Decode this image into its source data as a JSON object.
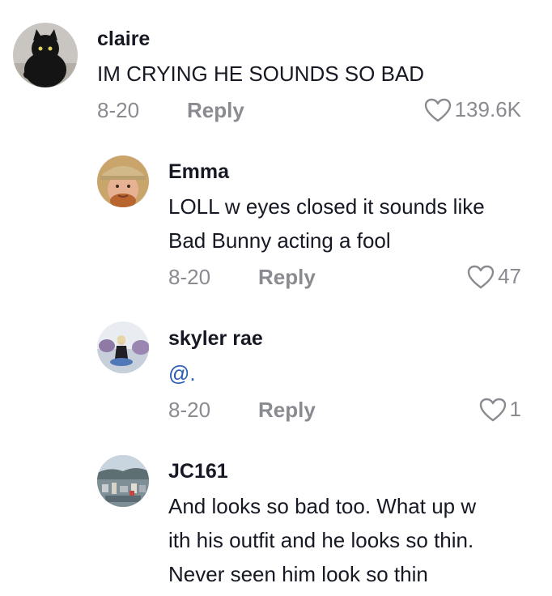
{
  "comments": [
    {
      "username": "claire",
      "text": "IM CRYING HE SOUNDS SO BAD",
      "date": "8-20",
      "reply_label": "Reply",
      "likes": "139.6K",
      "avatar_icon": "black-cat-avatar"
    },
    {
      "username": "Emma",
      "text_line1": "LOLL w eyes closed it sounds like",
      "text_line2": "Bad Bunny acting a fool",
      "date": "8-20",
      "reply_label": "Reply",
      "likes": "47",
      "avatar_icon": "ginger-man-with-hat-avatar"
    },
    {
      "username": "skyler rae",
      "text": "@.",
      "date": "8-20",
      "reply_label": "Reply",
      "likes": "1",
      "avatar_icon": "person-outdoors-avatar"
    },
    {
      "username": "JC161",
      "text_line1": "And looks so bad too. What up w",
      "text_line2": "ith his outfit and he looks so thin.",
      "text_line3": "Never seen him look so thin",
      "avatar_icon": "harbor-cityscape-avatar"
    }
  ],
  "colors": {
    "text_primary": "#161823",
    "text_secondary": "#8a8b91",
    "mention": "#2b5db9",
    "background": "#ffffff"
  }
}
